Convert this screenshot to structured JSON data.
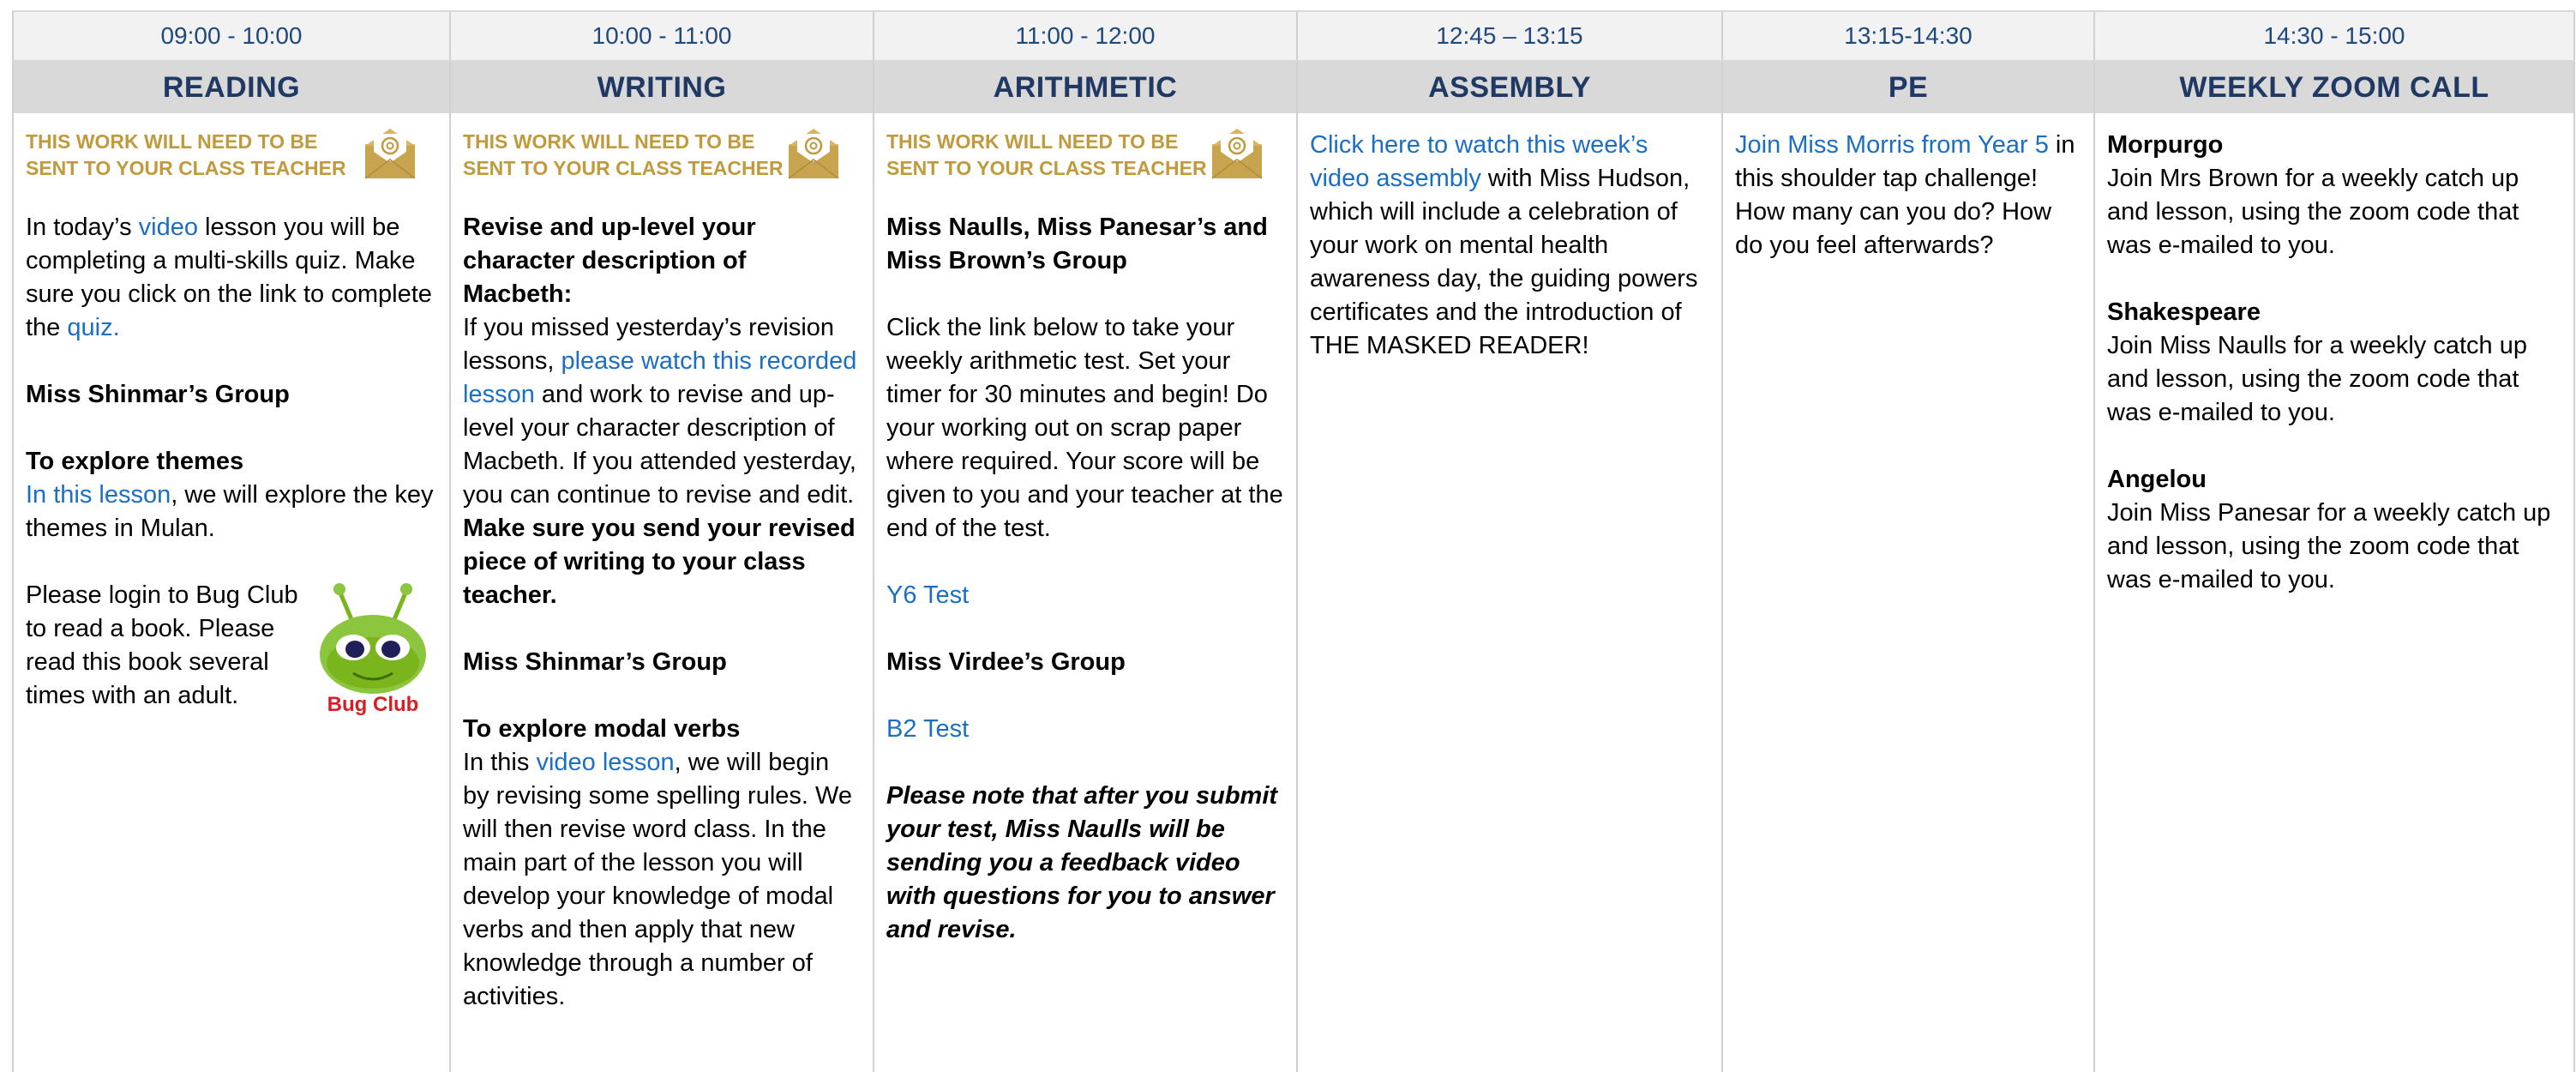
{
  "columns": [
    {
      "time": "09:00 - 10:00",
      "subject": "READING"
    },
    {
      "time": "10:00 - 11:00",
      "subject": "WRITING"
    },
    {
      "time": "11:00 - 12:00",
      "subject": "ARITHMETIC"
    },
    {
      "time": "12:45 – 13:15",
      "subject": "ASSEMBLY"
    },
    {
      "time": "13:15-14:30",
      "subject": "PE"
    },
    {
      "time": "14:30 - 15:00",
      "subject": "WEEKLY ZOOM CALL"
    }
  ],
  "notice": "THIS WORK WILL NEED TO BE SENT TO YOUR CLASS TEACHER",
  "reading": {
    "intro_a": "In today’s ",
    "video_link": "video",
    "intro_b": " lesson you will be completing a multi-skills quiz. Make sure you click on the link to complete the ",
    "quiz_link": "quiz.",
    "group": "Miss Shinmar’s Group",
    "heading": "To explore themes",
    "lesson_link": "In this lesson",
    "lesson_text": ", we will explore the key themes in Mulan.",
    "bug_text": "Please login to Bug Club to read a book. Please read this book several times with an adult.",
    "bug_logo": "Bug Club"
  },
  "writing": {
    "heading": "Revise and up-level your character description of Macbeth:",
    "t1": "If you missed yesterday’s revision lessons, ",
    "link1": "please watch this recorded lesson",
    "t2": " and work to revise and up-level your character description of Macbeth. If you attended yesterday, you can continue to revise and edit. ",
    "bold2": "Make sure you send your revised piece of writing to your class teacher.",
    "group": "Miss Shinmar’s Group",
    "heading2": "To explore modal verbs",
    "t3": "In this ",
    "link2": "video lesson",
    "t4": ", we will begin by revising some spelling rules. We will then revise word class. In the main part of the lesson you will develop your knowledge of modal verbs and then apply that new knowledge through a number of activities."
  },
  "arithmetic": {
    "group1": "Miss Naulls, Miss Panesar’s and Miss Brown’s Group",
    "text": "Click the link below to take your weekly arithmetic test. Set your timer for 30 minutes and begin! Do your working out on scrap paper where required. Your score will be given to you and your teacher at the end of the test.",
    "link1": "Y6 Test",
    "group2": "Miss Virdee’s Group",
    "link2": "B2 Test",
    "note": "Please note that after you submit your test, Miss Naulls will be sending you a feedback video with questions for you to answer and revise."
  },
  "assembly": {
    "link": "Click here to watch this week’s video assembly",
    "text": " with Miss Hudson, which will include a celebration of your work on mental health awareness day, the guiding powers certificates and the introduction of THE MASKED READER!"
  },
  "pe": {
    "link": "Join Miss Morris from Year 5",
    "text": " in this shoulder tap challenge! How many can you do? How do you feel afterwards?"
  },
  "zoom": {
    "groups": [
      {
        "name": "Morpurgo",
        "text": "Join Mrs Brown for a weekly catch up and lesson, using the zoom code that was e-mailed to you."
      },
      {
        "name": "Shakespeare",
        "text": "Join Miss Naulls for a weekly catch up and lesson, using the zoom code that was e-mailed to you."
      },
      {
        "name": "Angelou",
        "text": "Join Miss Panesar for a weekly catch up and lesson, using the zoom code that was e-mailed to you."
      }
    ]
  },
  "colors": {
    "header_text": "#1f3864",
    "link": "#1a6fc4",
    "notice": "#c09a3c",
    "subject_bg": "#d9d9d9",
    "time_bg": "#f2f2f2"
  },
  "icons": {
    "notice": "envelope-at-icon",
    "reading": "bug-club-logo"
  }
}
